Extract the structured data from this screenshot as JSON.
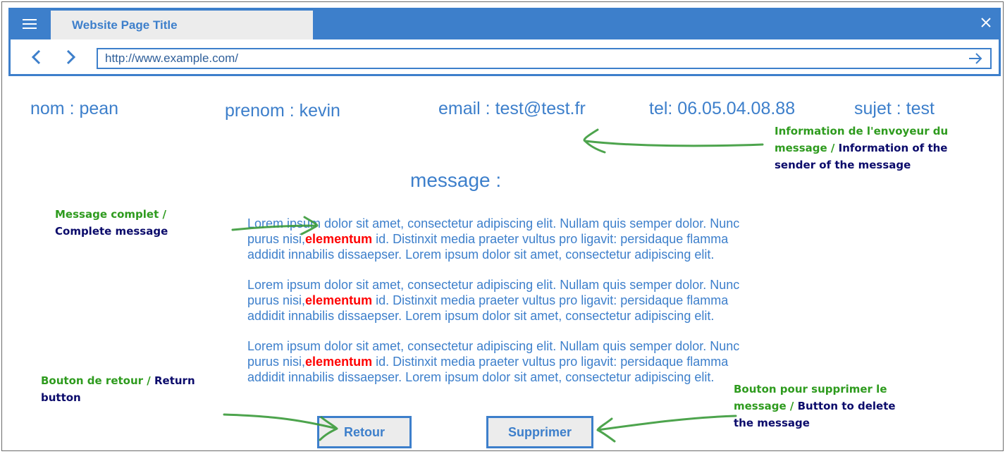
{
  "browser": {
    "tab_title": "Website Page Title",
    "url": "http://www.example.com/",
    "icons": {
      "menu": "hamburger-icon",
      "close": "close-icon",
      "back": "chevron-left-icon",
      "forward": "chevron-right-icon",
      "go": "arrow-right-icon"
    },
    "colors": {
      "chrome": "#3d7fcb",
      "tab": "#ececec"
    }
  },
  "sender": {
    "nom": "nom : pean",
    "prenom": "prenom : kevin",
    "email": "email : test@test.fr",
    "tel": "tel: 06.05.04.08.88",
    "sujet": "sujet : test"
  },
  "message": {
    "label": "message :",
    "paragraphs": [
      {
        "before": "Lorem ipsum dolor sit amet, consectetur adipiscing elit. Nullam quis semper dolor. Nunc purus nisi,",
        "highlight": "elementum",
        "after": " id. Distinxit  media praeter vultus pro ligavit: persidaque flamma addidit innabilis dissaepser. Lorem ipsum dolor sit amet, consectetur adipiscing elit."
      },
      {
        "before": "Lorem ipsum dolor sit amet, consectetur adipiscing elit. Nullam quis semper dolor. Nunc purus nisi,",
        "highlight": "elementum",
        "after": " id. Distinxit  media praeter vultus pro ligavit: persidaque flamma addidit innabilis dissaepser. Lorem ipsum dolor sit amet, consectetur adipiscing elit."
      },
      {
        "before": "Lorem ipsum dolor sit amet, consectetur adipiscing elit. Nullam quis semper dolor. Nunc purus nisi,",
        "highlight": "elementum",
        "after": " id. Distinxit  media praeter vultus pro ligavit: persidaque flamma addidit innabilis dissaepser. Lorem ipsum dolor sit amet, consectetur adipiscing elit."
      }
    ],
    "highlight_color": "#ff0000"
  },
  "buttons": {
    "retour": "Retour",
    "supprimer": "Supprimer"
  },
  "annotations": {
    "sender": {
      "fr": "Information de l'envoyeur du message /",
      "en": " Information of the sender of the message"
    },
    "message": {
      "fr": "Message complet /",
      "en": " Complete message"
    },
    "return": {
      "fr": "Bouton de retour /",
      "en": " Return button"
    },
    "delete": {
      "fr": "Bouton pour supprimer le message /",
      "en": " Button to delete the message"
    },
    "colors": {
      "french": "#2e9b1e",
      "english": "#0b0b6b",
      "arrows": "#3a9a3a"
    }
  }
}
